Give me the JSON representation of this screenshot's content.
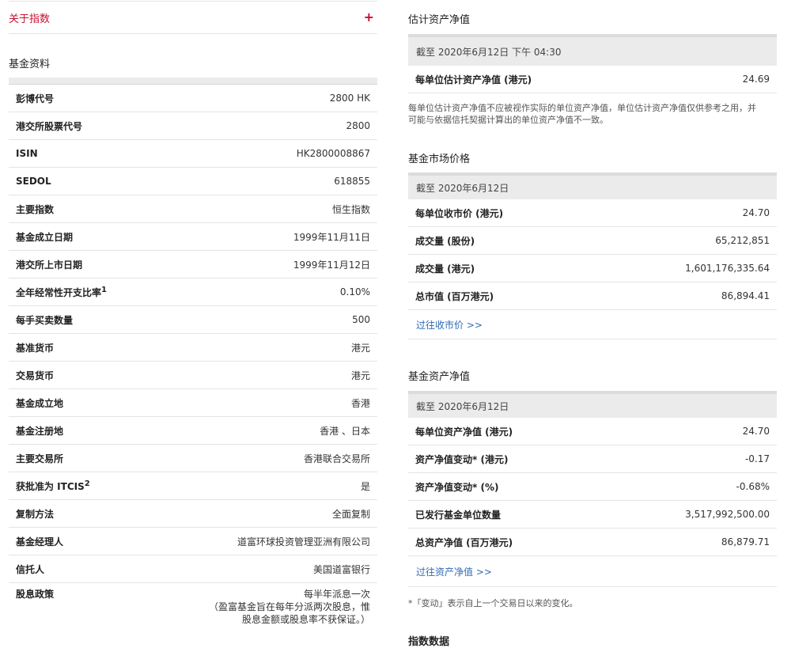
{
  "left": {
    "about_label": "关于指数",
    "fund_info_title": "基金资料",
    "rows": [
      {
        "key": "彭博代号",
        "value": "2800 HK"
      },
      {
        "key": "港交所股票代号",
        "value": "2800"
      },
      {
        "key": "ISIN",
        "value": "HK2800008867"
      },
      {
        "key": "SEDOL",
        "value": "618855"
      },
      {
        "key": "主要指数",
        "value": "恒生指数"
      },
      {
        "key": "基金成立日期",
        "value": "1999年11月11日"
      },
      {
        "key": "港交所上市日期",
        "value": "1999年11月12日"
      },
      {
        "key": "全年经常性开支比率",
        "sup": "1",
        "value": "0.10%"
      },
      {
        "key": "每手买卖数量",
        "value": "500"
      },
      {
        "key": "基准货币",
        "value": "港元"
      },
      {
        "key": "交易货币",
        "value": "港元"
      },
      {
        "key": "基金成立地",
        "value": "香港"
      },
      {
        "key": "基金注册地",
        "value": "香港 、日本"
      },
      {
        "key": "主要交易所",
        "value": "香港联合交易所"
      },
      {
        "key": "获批准为 ITCIS",
        "sup": "2",
        "value": "是"
      },
      {
        "key": "复制方法",
        "value": "全面复制"
      },
      {
        "key": "基金经理人",
        "value": "道富环球投资管理亚洲有限公司"
      },
      {
        "key": "信托人",
        "value": "美国道富银行"
      }
    ],
    "dividend": {
      "key": "股息政策",
      "line1": "每半年派息一次",
      "line2": "（盈富基金旨在每年分派两次股息，惟",
      "line3": "股息金额或股息率不获保证。）"
    }
  },
  "right": {
    "est_nav": {
      "title": "估计资产净值",
      "date": "截至 2020年6月12日 下午 04:30",
      "rows": [
        {
          "key": "每单位估计资产净值 (港元)",
          "value": "24.69"
        }
      ],
      "note": "每单位估计资产净值不应被视作实际的单位资产净值，单位估计资产净值仅供参考之用，并可能与依据信托契据计算出的单位资产净值不一致。"
    },
    "market_price": {
      "title": "基金市场价格",
      "date": "截至 2020年6月12日",
      "rows": [
        {
          "key": "每单位收市价 (港元)",
          "value": "24.70"
        },
        {
          "key": "成交量 (股份)",
          "value": "65,212,851"
        },
        {
          "key": "成交量 (港元)",
          "value": "1,601,176,335.64"
        },
        {
          "key": "总市值 (百万港元)",
          "value": "86,894.41"
        }
      ],
      "link": "过往收市价 >>"
    },
    "nav": {
      "title": "基金资产净值",
      "date": "截至 2020年6月12日",
      "rows": [
        {
          "key": "每单位资产净值 (港元)",
          "value": "24.70"
        },
        {
          "key": "资产净值变动* (港元)",
          "value": "-0.17"
        },
        {
          "key": "资产净值变动* (%)",
          "value": "-0.68%"
        },
        {
          "key": "已发行基金单位数量",
          "value": "3,517,992,500.00"
        },
        {
          "key": "总资产净值 (百万港元)",
          "value": "86,879.71"
        }
      ],
      "link": "过往资产净值 >>",
      "note": "*「变动」表示自上一个交易日以来的变化。"
    },
    "cut_title": "指数数据"
  },
  "colors": {
    "accent_red": "#c8102e",
    "link_blue": "#2f6bb4"
  }
}
